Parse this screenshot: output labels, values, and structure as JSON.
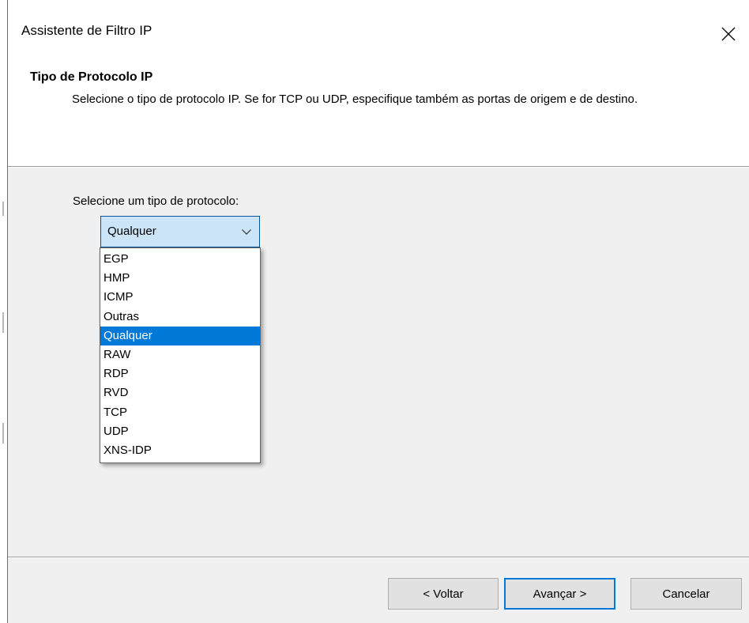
{
  "window": {
    "title": "Assistente de Filtro IP",
    "close_icon": "close-icon"
  },
  "header": {
    "title": "Tipo de Protocolo IP",
    "description": "Selecione o tipo de protocolo IP. Se for TCP ou UDP, especifique também as portas de origem e de destino."
  },
  "protocol": {
    "label": "Selecione um tipo de protocolo:",
    "selected": "Qualquer",
    "arrow_icon": "chevron-down-icon",
    "options": [
      "EGP",
      "HMP",
      "ICMP",
      "Outras",
      "Qualquer",
      "RAW",
      "RDP",
      "RVD",
      "TCP",
      "UDP",
      "XNS-IDP"
    ],
    "highlighted_index": 4
  },
  "buttons": {
    "back": "< Voltar",
    "next": "Avançar >",
    "cancel": "Cancelar"
  },
  "colors": {
    "selection": "#0078d7",
    "combo_focus_bg": "#cce4f7",
    "dialog_bg": "#f0f0f0"
  }
}
